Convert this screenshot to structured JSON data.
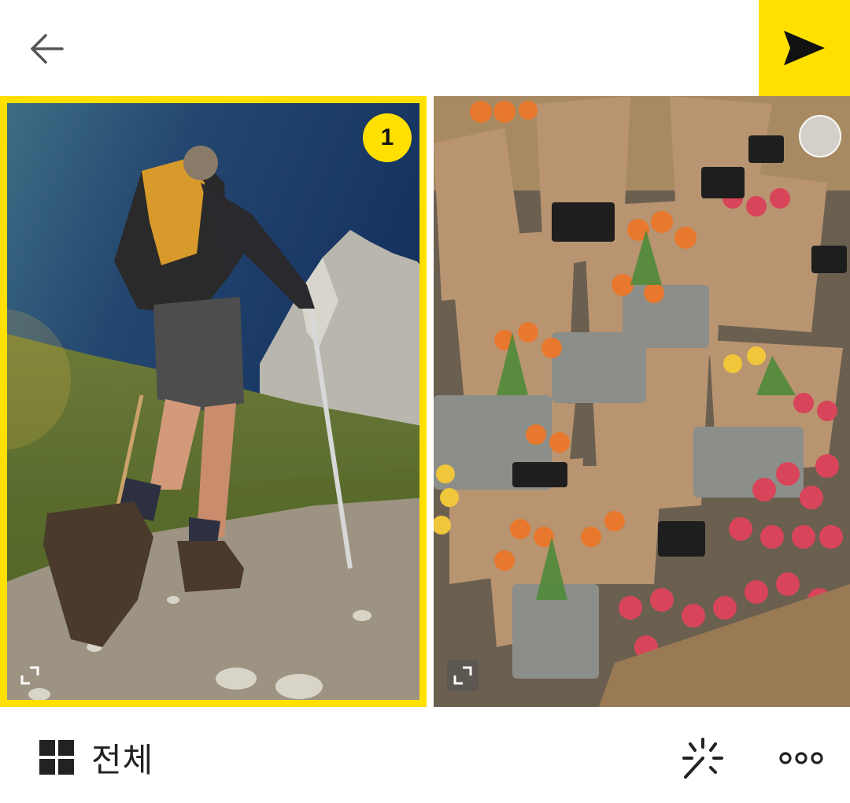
{
  "header": {
    "back_icon": "arrow-left-icon",
    "send_icon": "send-paper-plane-icon",
    "accent_color": "#FFE000"
  },
  "photos": [
    {
      "selected": true,
      "selection_number": "1",
      "subject": "hiker-on-mountain-trail"
    },
    {
      "selected": false,
      "selection_number": "",
      "subject": "tulip-bouquets-in-buckets"
    }
  ],
  "toolbar": {
    "all_label": "전체",
    "all_icon": "grid-icon",
    "magic_icon": "magic-sparkle-icon",
    "more_icon": "more-dots-icon"
  }
}
